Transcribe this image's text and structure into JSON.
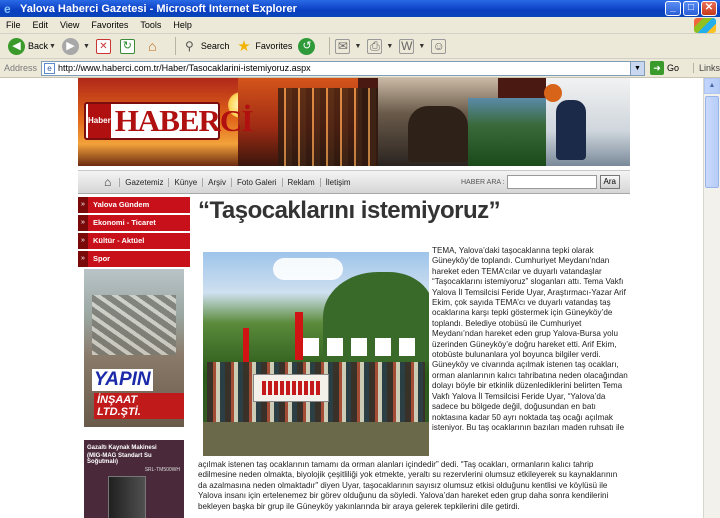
{
  "window": {
    "title": "Yalova Haberci Gazetesi - Microsoft Internet Explorer",
    "minimize_glyph": "_",
    "maximize_glyph": "□",
    "close_glyph": "✕"
  },
  "menu": [
    "File",
    "Edit",
    "View",
    "Favorites",
    "Tools",
    "Help"
  ],
  "toolbar": {
    "back_label": "Back",
    "search_label": "Search",
    "favorites_label": "Favorites"
  },
  "address": {
    "label": "Address",
    "url": "http://www.haberci.com.tr/Haber/Tasocaklarini-istemiyoruz.aspx",
    "go_label": "Go",
    "links_label": "Links"
  },
  "site": {
    "logo_h": "Haber",
    "logo_text": "HABERCİ",
    "nav": [
      "Gazetemiz",
      "Künye",
      "Arşiv",
      "Foto Galeri",
      "Reklam",
      "İletişim"
    ],
    "search_label": "HABER ARA :",
    "search_placeholder": "",
    "search_button": "Ara"
  },
  "sidebar": {
    "categories": [
      "Yalova Gündem",
      "Ekonomi - Ticaret",
      "Kültür - Aktüel",
      "Spor"
    ],
    "ad1_brand": "YAPIN",
    "ad1_sub": "İNŞAAT LTD.ŞTİ.",
    "ad2_title": "Gazaltı Kaynak Makinesi",
    "ad2_sub": "(MIG-MAG Standart Su Soğutmalı)",
    "ad2_model": "SRL-TM500WH"
  },
  "article": {
    "headline": "“Taşocaklarını istemiyoruz”",
    "body_right": "TEMA, Yalova’daki taşocaklarına tepki olarak Güneyköy’de toplandı. Cumhuriyet Meydanı’ndan hareket eden TEMA’cılar ve duyarlı vatandaşlar “Taşocaklarını istemiyoruz” sloganları attı. Tema Vakfı Yalova İl Temsilcisi Feride Uyar, Araştırmacı-Yazar Arif Ekim, çok sayıda TEMA’cı ve duyarlı vatandaş taş ocaklarına  karşı tepki göstermek için Güneyköy’de toplandı. Belediye otobüsü ile Cumhuriyet Meydanı’ndan hareket eden grup Yalova-Bursa yolu üzerinden Güneyköy’e doğru hareket etti. Arif Ekim, otobüste bulunanlara yol boyunca bilgiler verdi. Güneyköy ve civarında açılmak istenen taş ocakları, orman alanlarının kalıcı tahribatına neden olacağından dolayı böyle bir etkinlik düzenlediklerini belirten Tema Vakfı Yalova İl Temsilcisi Feride Uyar, “Yalova’da sadece bu bölgede değil, doğusundan en batı noktasına kadar 50 ayrı noktada taş ocağı açılmak isteniyor. Bu taş ocaklarının bazıları maden ruhsatı ile",
    "body_full": "açılmak istenen taş ocaklarının tamamı da orman alanları içindedir” dedi. “Taş ocakları, ormanların kalıcı tahrip edilmesine neden olmakta, biyolojik çeşitliliği yok etmekte, yeraltı su rezervlerini olumsuz etkileyerek su kaynaklarının da azalmasına neden olmaktadır” diyen Uyar,  taşocaklarının sayısız olumsuz etkisi olduğunu kentlisi ve köylüsü ile Yalova insanı için ertelenemez bir görev olduğunu da söyledi. Yalova’dan hareket eden grup daha sonra kendilerini bekleyen başka bir grup ile Güneyköy yakınlarında bir araya gelerek tepkilerini dile getirdi."
  }
}
